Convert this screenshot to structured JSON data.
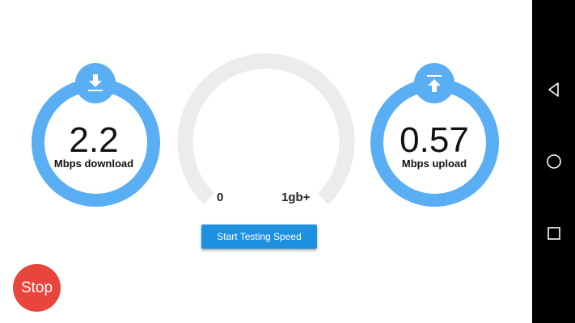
{
  "download": {
    "value": "2.2",
    "unit_label": "Mbps download",
    "icon": "download-icon"
  },
  "upload": {
    "value": "0.57",
    "unit_label": "Mbps upload",
    "icon": "upload-icon"
  },
  "gauge": {
    "min_label": "0",
    "max_label": "1gb+",
    "level": 0
  },
  "actions": {
    "start_label": "Start Testing Speed",
    "stop_label": "Stop"
  },
  "navbar": {
    "buttons": [
      "back-icon",
      "home-icon",
      "recents-icon"
    ]
  },
  "colors": {
    "accent": "#5aaef3",
    "button": "#1e90e0",
    "stop": "#e8453c",
    "gauge_track": "#ececec"
  }
}
